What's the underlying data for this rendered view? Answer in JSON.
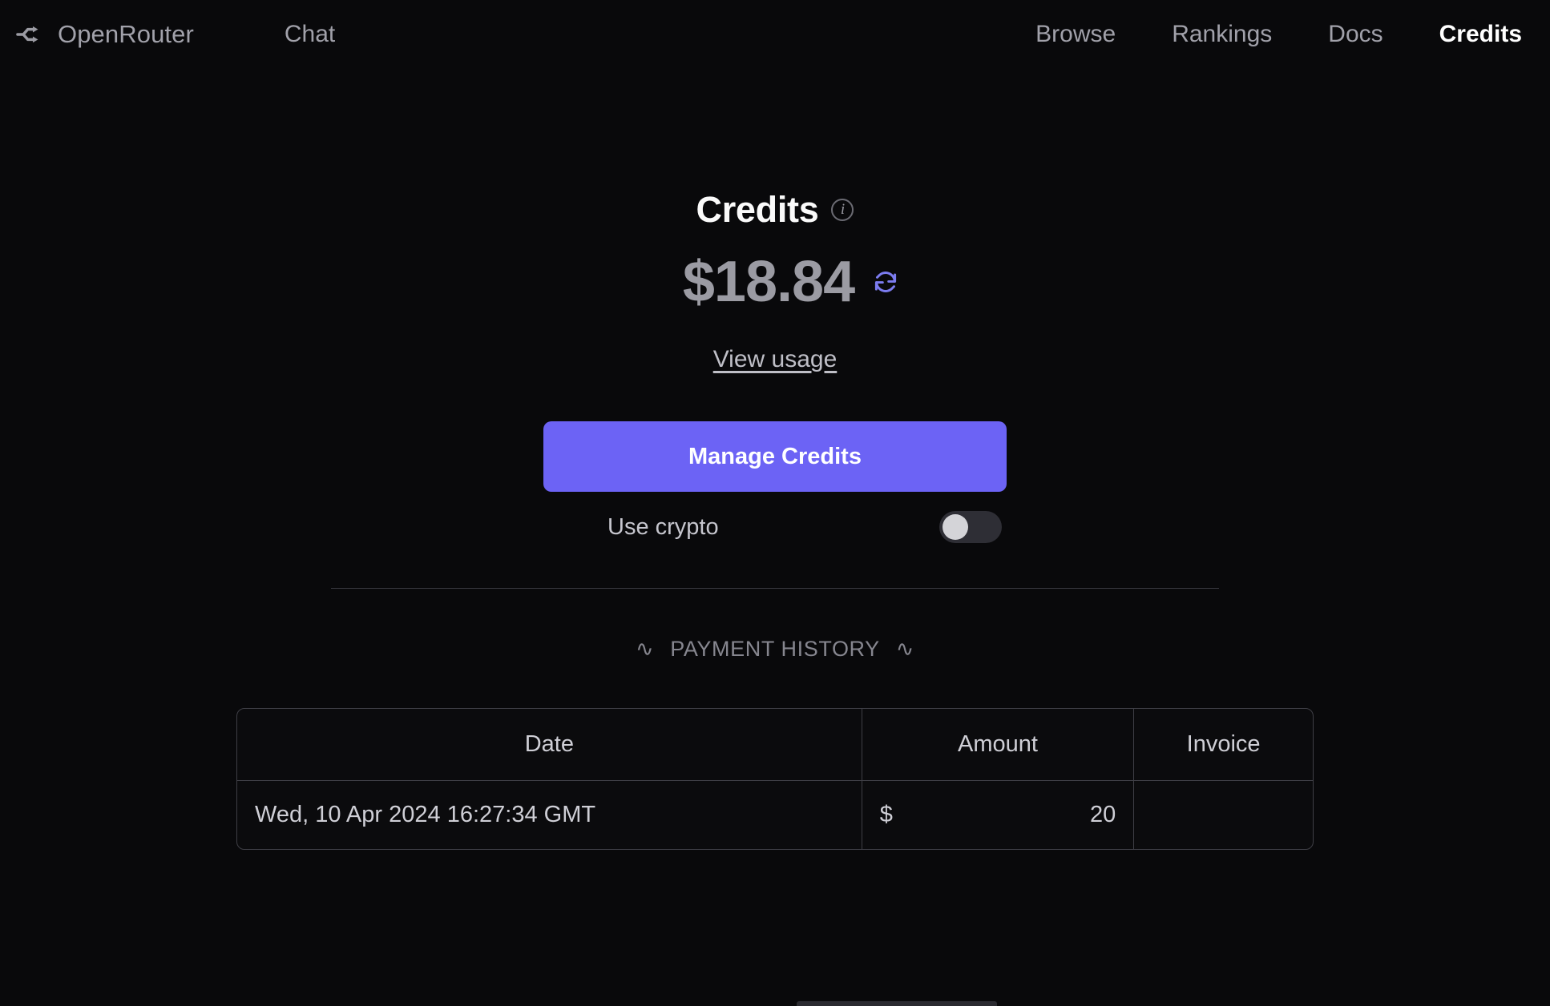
{
  "colors": {
    "background": "#09090b",
    "accent": "#6c63f5",
    "refresh_icon": "#7c7cf0",
    "muted_text": "#a1a1aa",
    "border": "#3f3f46"
  },
  "navbar": {
    "brand_name": "OpenRouter",
    "brand_logo_icon": "openrouter-logo-icon",
    "left_links": [
      {
        "label": "Chat",
        "active": false
      }
    ],
    "right_links": [
      {
        "label": "Browse",
        "active": false
      },
      {
        "label": "Rankings",
        "active": false
      },
      {
        "label": "Docs",
        "active": false
      },
      {
        "label": "Credits",
        "active": true
      }
    ]
  },
  "credits": {
    "title": "Credits",
    "info_icon": "info-circle-icon",
    "info_icon_glyph": "i",
    "balance": "$18.84",
    "refresh_icon": "refresh-sync-icon",
    "view_usage_label": "View usage",
    "manage_button_label": "Manage Credits",
    "crypto_toggle": {
      "label": "Use crypto",
      "state": "off"
    }
  },
  "payment_history": {
    "heading": "PAYMENT HISTORY",
    "heading_ornament_left": "∿",
    "heading_ornament_right": "∿",
    "columns": [
      "Date",
      "Amount",
      "Invoice"
    ],
    "rows": [
      {
        "date": "Wed, 10 Apr 2024 16:27:34 GMT",
        "amount_currency": "$",
        "amount_value": "20",
        "invoice": ""
      }
    ]
  }
}
